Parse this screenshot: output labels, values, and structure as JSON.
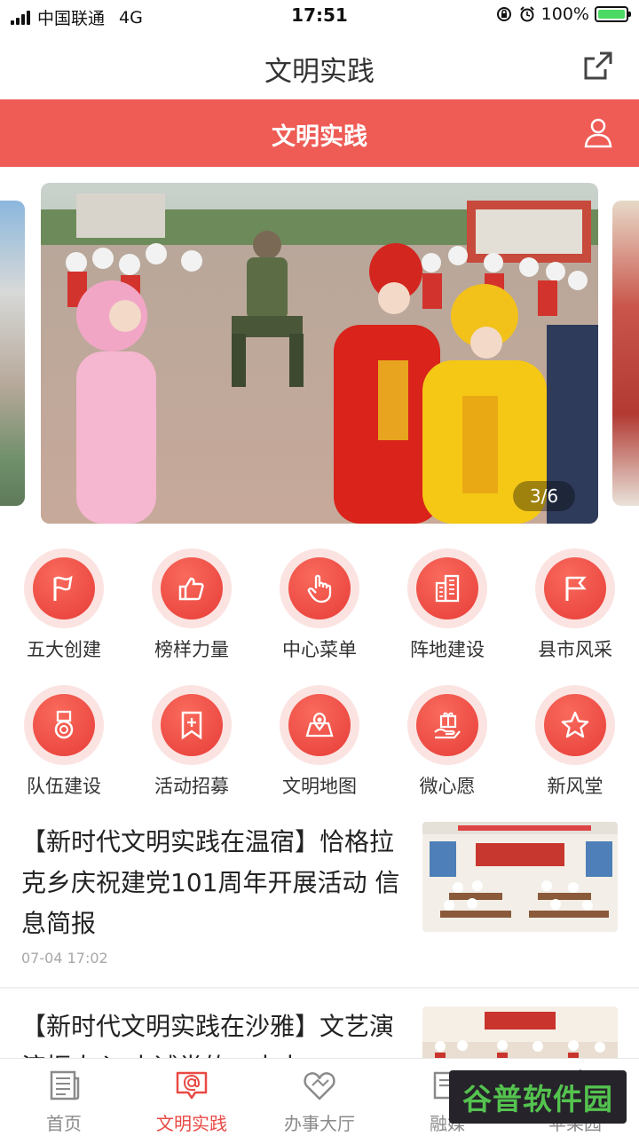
{
  "status_bar": {
    "carrier": "中国联通",
    "network": "4G",
    "time": "17:51",
    "battery": "100%"
  },
  "nav": {
    "title": "文明实践"
  },
  "header": {
    "title": "文明实践"
  },
  "banner": {
    "counter": "3/6",
    "current": 3,
    "total": 6
  },
  "grid": {
    "row1": [
      {
        "label": "五大创建",
        "icon": "flag-icon"
      },
      {
        "label": "榜样力量",
        "icon": "thumbs-up-icon"
      },
      {
        "label": "中心菜单",
        "icon": "hand-pointer-icon"
      },
      {
        "label": "阵地建设",
        "icon": "building-icon"
      },
      {
        "label": "县市风采",
        "icon": "flag-square-icon"
      }
    ],
    "row2": [
      {
        "label": "队伍建设",
        "icon": "medal-icon"
      },
      {
        "label": "活动招募",
        "icon": "bookmark-plus-icon"
      },
      {
        "label": "文明地图",
        "icon": "map-pin-icon"
      },
      {
        "label": "微心愿",
        "icon": "gift-hand-icon"
      },
      {
        "label": "新风堂",
        "icon": "star-icon"
      }
    ]
  },
  "news": [
    {
      "title": "【新时代文明实践在温宿】恰格拉克乡庆祝建党101周年开展活动 信息简报",
      "time": "07-04 17:02"
    },
    {
      "title": "【新时代文明实践在沙雅】文艺演演振人心 赤诚党的二十大"
    }
  ],
  "tabs": [
    {
      "label": "首页",
      "icon": "newspaper-icon"
    },
    {
      "label": "文明实践",
      "icon": "chat-at-icon"
    },
    {
      "label": "办事大厅",
      "icon": "heart-icon"
    },
    {
      "label": "融媒",
      "icon": "media-icon"
    },
    {
      "label": "苹果园",
      "icon": "apple-icon"
    }
  ],
  "watermark": {
    "text": "谷普软件园"
  },
  "colors": {
    "accent": "#ef5b55",
    "icon_red": "#e73d38",
    "active_tab": "#e94a45"
  }
}
